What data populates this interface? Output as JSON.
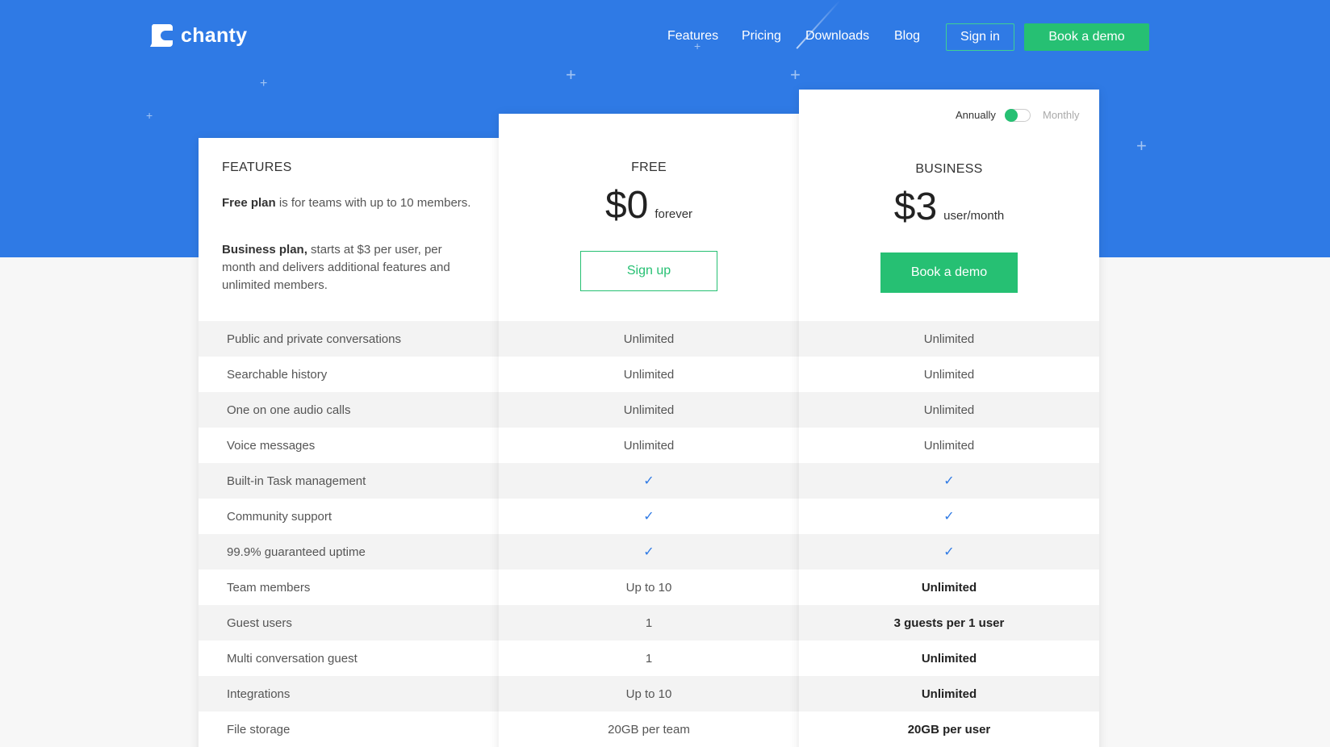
{
  "brand": {
    "name": "chanty",
    "colors": {
      "primary": "#2f7ae5",
      "accent": "#26c073"
    }
  },
  "nav": {
    "links": [
      "Features",
      "Pricing",
      "Downloads",
      "Blog"
    ],
    "sign_in": "Sign in",
    "book_demo": "Book a demo"
  },
  "features_col": {
    "title": "FEATURES",
    "free_desc_bold": "Free plan",
    "free_desc_rest": " is for teams with up to 10 members.",
    "biz_desc_bold": "Business plan,",
    "biz_desc_rest": " starts at $3 per user, per month and delivers additional features and unlimited members.",
    "rows": [
      "Public and private conversations",
      "Searchable history",
      "One on one audio calls",
      "Voice messages",
      "Built-in Task management",
      "Community support",
      "99.9% guaranteed uptime",
      "Team members",
      "Guest users",
      "Multi conversation guest",
      "Integrations",
      "File storage"
    ]
  },
  "free_col": {
    "name": "FREE",
    "price": "$0",
    "unit": "forever",
    "button": "Sign up",
    "rows": [
      "Unlimited",
      "Unlimited",
      "Unlimited",
      "Unlimited",
      "✓",
      "✓",
      "✓",
      "Up to 10",
      "1",
      "1",
      "Up to 10",
      "20GB per team"
    ]
  },
  "business_col": {
    "billing_annually": "Annually",
    "billing_monthly": "Monthly",
    "name": "BUSINESS",
    "price": "$3",
    "unit": "user/month",
    "button": "Book a demo",
    "rows": [
      "Unlimited",
      "Unlimited",
      "Unlimited",
      "Unlimited",
      "✓",
      "✓",
      "✓",
      "Unlimited",
      "3 guests per 1 user",
      "Unlimited",
      "Unlimited",
      "20GB per user"
    ]
  }
}
